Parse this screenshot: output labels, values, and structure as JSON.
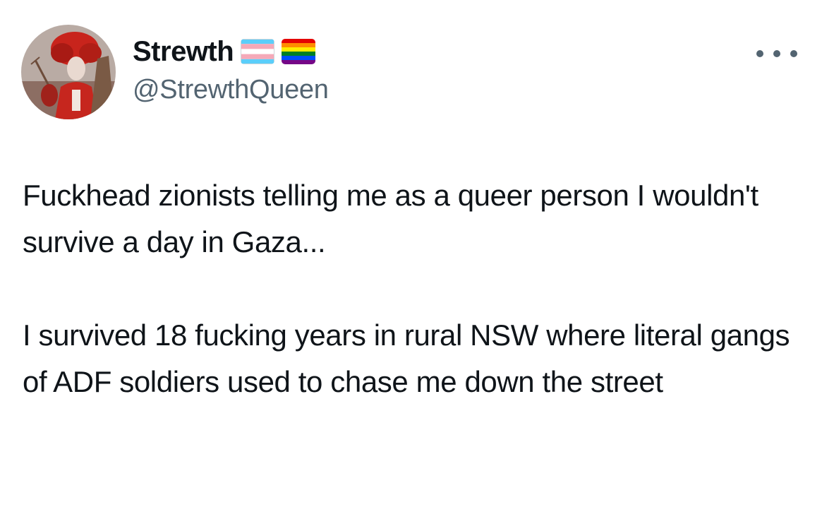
{
  "tweet": {
    "author": {
      "display_name": "Strewth",
      "handle": "@StrewthQueen",
      "flags": [
        "transgender-flag-icon",
        "rainbow-flag-icon"
      ],
      "avatar": "avatar-image"
    },
    "more_icon": "more-options-icon",
    "paragraphs": [
      "Fuckhead zionists telling me as a queer person I wouldn't survive a day in Gaza...",
      "I survived 18 fucking years in rural NSW where literal gangs of ADF soldiers used to chase me down the street"
    ]
  },
  "colors": {
    "text_primary": "#0f1419",
    "text_secondary": "#536471",
    "background": "#ffffff"
  }
}
